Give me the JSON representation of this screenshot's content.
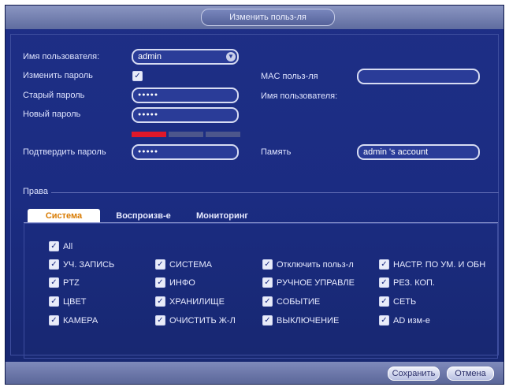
{
  "window": {
    "title": "Изменить польз-ля"
  },
  "form": {
    "username_label": "Имя пользователя:",
    "username_value": "admin",
    "change_password_label": "Изменить пароль",
    "old_password_label": "Старый пароль",
    "old_password_value": "●●●●●",
    "new_password_label": "Новый пароль",
    "new_password_value": "●●●●●",
    "confirm_password_label": "Подтвердить пароль",
    "confirm_password_value": "●●●●●",
    "mac_label": "MAC польз-ля",
    "mac_value": "",
    "username_label_right": "Имя пользователя:",
    "memo_label": "Память",
    "memo_value": "admin 's account",
    "password_strength": 0.25
  },
  "rights": {
    "label": "Права",
    "tabs": [
      "Система",
      "Воспроизв-е",
      "Мониторинг"
    ],
    "all_label": "All",
    "columns": [
      [
        "УЧ. ЗАПИСЬ",
        "PTZ",
        "ЦВЕТ",
        "КАМЕРА"
      ],
      [
        "СИСТЕМА",
        "ИНФО",
        "ХРАНИЛИЩЕ",
        "ОЧИСТИТЬ Ж-Л"
      ],
      [
        "Отключить польз-л",
        "РУЧНОЕ УПРАВЛЕ",
        "СОБЫТИЕ",
        "ВЫКЛЮЧЕНИЕ"
      ],
      [
        "НАСТР. ПО УМ. И ОБН",
        "РЕЗ. КОП.",
        "СЕТЬ",
        "AD изм-е"
      ]
    ]
  },
  "buttons": {
    "save": "Сохранить",
    "cancel": "Отмена"
  },
  "colors": {
    "window_bg": "#1e2f86",
    "accent_tab": "#d87a00",
    "strength_red": "#e0182a"
  }
}
